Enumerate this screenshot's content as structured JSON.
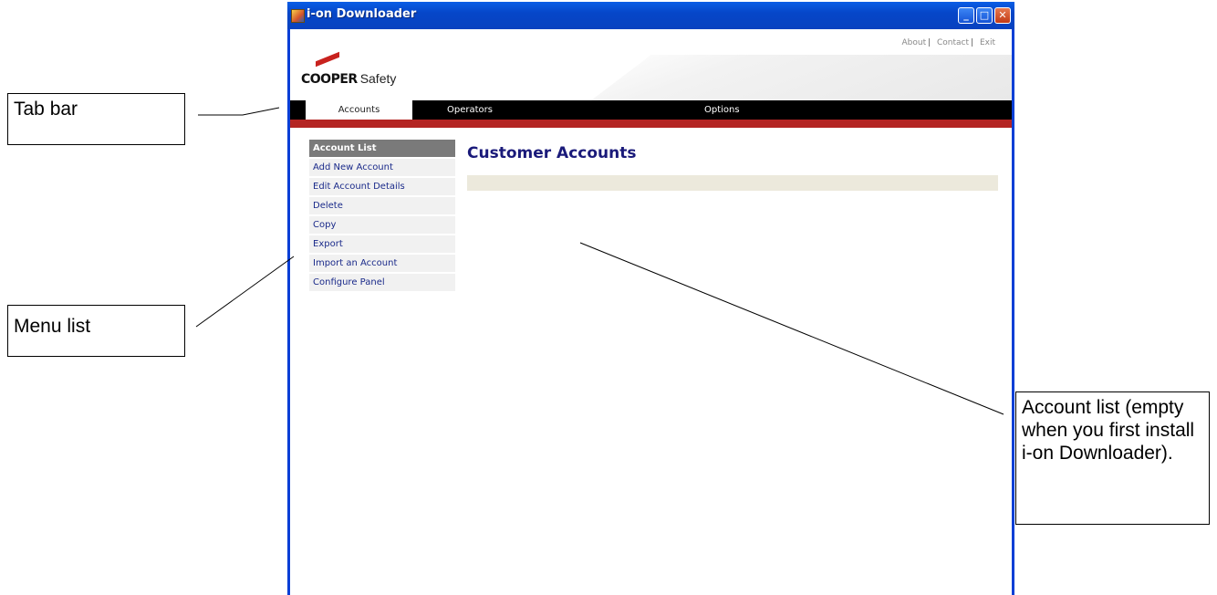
{
  "callouts": {
    "tab_bar": "Tab bar",
    "menu_list": "Menu list",
    "account_list": "Account list (empty when you first install i-on Downloader)."
  },
  "window": {
    "title": "i-on Downloader",
    "buttons": {
      "minimize": "_",
      "maximize": "□",
      "close": "✕"
    }
  },
  "header": {
    "links": [
      "About",
      "Contact",
      "Exit"
    ],
    "separator": "|",
    "logo_word": "COOPER",
    "logo_safety": "Safety"
  },
  "tabs": [
    {
      "label": "Accounts",
      "active": true
    },
    {
      "label": "Operators",
      "active": false
    },
    {
      "label": "Options",
      "active": false
    }
  ],
  "sidebar": {
    "items": [
      {
        "label": "Account List",
        "active": true
      },
      {
        "label": "Add New Account"
      },
      {
        "label": "Edit Account Details"
      },
      {
        "label": "Delete"
      },
      {
        "label": "Copy"
      },
      {
        "label": "Export"
      },
      {
        "label": "Import an Account"
      },
      {
        "label": "Configure Panel"
      }
    ]
  },
  "main": {
    "title": "Customer Accounts"
  },
  "colors": {
    "titlebar": "#0a5ee6",
    "tab_red": "#b42523",
    "heading": "#1a1a7a",
    "menu_active": "#7a7a7a",
    "list_header": "#ece9dc"
  }
}
